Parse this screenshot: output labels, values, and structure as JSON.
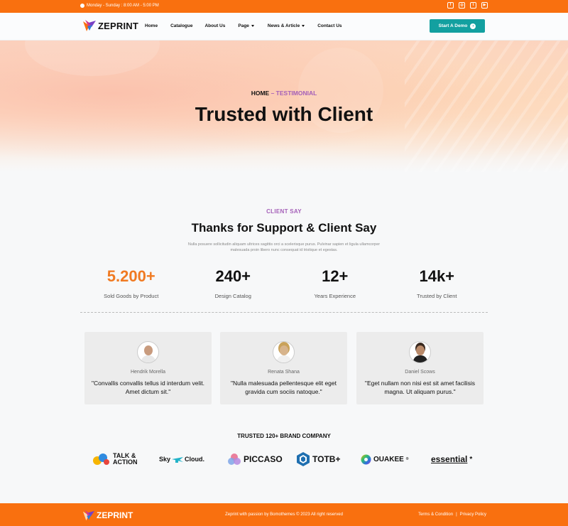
{
  "topbar": {
    "hours": "Monday - Sunday : 8:00 AM - 5:00 PM"
  },
  "brand": {
    "name": "ZEPRINT"
  },
  "nav": {
    "home": "Home",
    "catalogue": "Catalogue",
    "about": "About Us",
    "page": "Page",
    "news": "News & Article",
    "contact": "Contact Us"
  },
  "cta": {
    "label": "Start A Demo"
  },
  "hero": {
    "breadcrumb_home": "HOME",
    "breadcrumb_sep": " – ",
    "breadcrumb_current": "TESTIMONIAL",
    "title": "Trusted with Client"
  },
  "section": {
    "eyebrow": "CLIENT SAY",
    "title": "Thanks for Support & Client Say",
    "description": "Nulla posuere sollicitudin aliquam ultrices sagittis orci a scelerisque purus. Pulvinar sapien et ligula ullamcorper malesuada proin libero nunc consequat id tristique et egestas."
  },
  "stats": [
    {
      "value": "5.200+",
      "label": "Sold Goods by Product"
    },
    {
      "value": "240+",
      "label": "Design Catalog"
    },
    {
      "value": "12+",
      "label": "Years Experience"
    },
    {
      "value": "14k+",
      "label": "Trusted by Client"
    }
  ],
  "testimonials": [
    {
      "name": "Hendrik Morella",
      "quote": "\"Convallis convallis tellus id interdum velit. Amet dictum sit.\""
    },
    {
      "name": "Renata Shana",
      "quote": "\"Nulla malesuada pellentesque elit eget gravida cum sociis natoque.\""
    },
    {
      "name": "Daniel Scows",
      "quote": "\"Eget nullam non nisi est sit amet facilisis magna. Ut aliquam purus.\""
    }
  ],
  "brands": {
    "heading": "TRUSTED 120+ BRAND COMPANY",
    "talk_line1": "TALK &",
    "talk_line2": "ACTION",
    "sky_a": "Sky",
    "sky_b": "Cloud.",
    "piccaso": "PICCASO",
    "totb": "TOTB+",
    "ouakee": "OUAKEE",
    "ouakee_mark": "®",
    "essential": "essential",
    "essential_mark": "*"
  },
  "footer": {
    "copyright": "Zeprint with passion by Bomothemes © 2023 All right reserved",
    "terms": "Terms & Condition",
    "sep": "|",
    "privacy": "Privacy Policy"
  },
  "colors": {
    "accent": "#f9700f",
    "teal": "#13a0a0",
    "purple": "#a45fb8",
    "stat_orange": "#f07a22"
  }
}
